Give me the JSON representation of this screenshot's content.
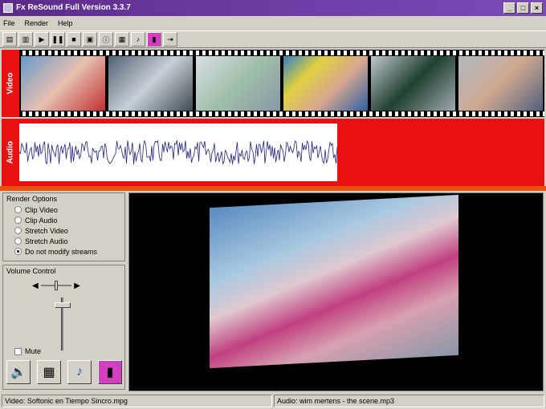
{
  "window": {
    "title": "Fx ReSound Full Version 3.3.7",
    "buttons": [
      "_",
      "□",
      "×"
    ]
  },
  "menu": [
    "File",
    "Render",
    "Help"
  ],
  "strips": {
    "video_label": "Video",
    "audio_label": "Audio"
  },
  "render_options": {
    "title": "Render Options",
    "options": [
      "Clip Video",
      "Clip Audio",
      "Stretch Video",
      "Stretch Audio",
      "Do not modify streams"
    ],
    "selected": "Do not modify streams"
  },
  "volume": {
    "title": "Volume Control",
    "mute_label": "Mute"
  },
  "status": {
    "video": "Video: Softonic en  Tiempo Sincro.mpg",
    "audio": "Audio: wim mertens - the scene.mp3"
  },
  "colors": {
    "title_bar": "#5a2a8a",
    "strip_red": "#e81010",
    "accent_orange": "#e85010"
  }
}
